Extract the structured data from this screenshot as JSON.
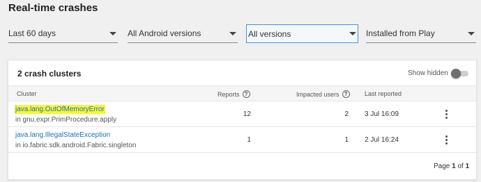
{
  "page": {
    "title": "Real-time crashes"
  },
  "filters": [
    {
      "label": "Last 60 days"
    },
    {
      "label": "All Android versions"
    },
    {
      "label": "All versions"
    },
    {
      "label": "Installed from Play"
    }
  ],
  "card": {
    "title": "2 crash clusters",
    "show_hidden_label": "Show hidden",
    "show_hidden_on": false
  },
  "table": {
    "headers": {
      "cluster": "Cluster",
      "reports": "Reports",
      "impacted_users": "Impacted users",
      "last_reported": "Last reported"
    },
    "rows": [
      {
        "exception": "java.lang.OutOfMemoryError",
        "location": "in gnu.expr.PrimProcedure.apply",
        "reports": "12",
        "impacted_users": "2",
        "last_reported": "3 Jul 16:09"
      },
      {
        "exception": "java.lang.IllegalStateException",
        "location": "in io.fabric.sdk.android.Fabric.singleton",
        "reports": "1",
        "impacted_users": "1",
        "last_reported": "2 Jul 16:24"
      }
    ]
  },
  "pagination": {
    "prefix": "Page",
    "current": "1",
    "of": "of",
    "total": "1"
  },
  "colors": {
    "link": "#1a6fc0",
    "highlight": "#f7f734",
    "active_border": "#4a90d9"
  },
  "icons": {
    "help": "help-circle-icon",
    "menu": "more-vert-icon",
    "dropdown": "chevron-down-icon"
  }
}
